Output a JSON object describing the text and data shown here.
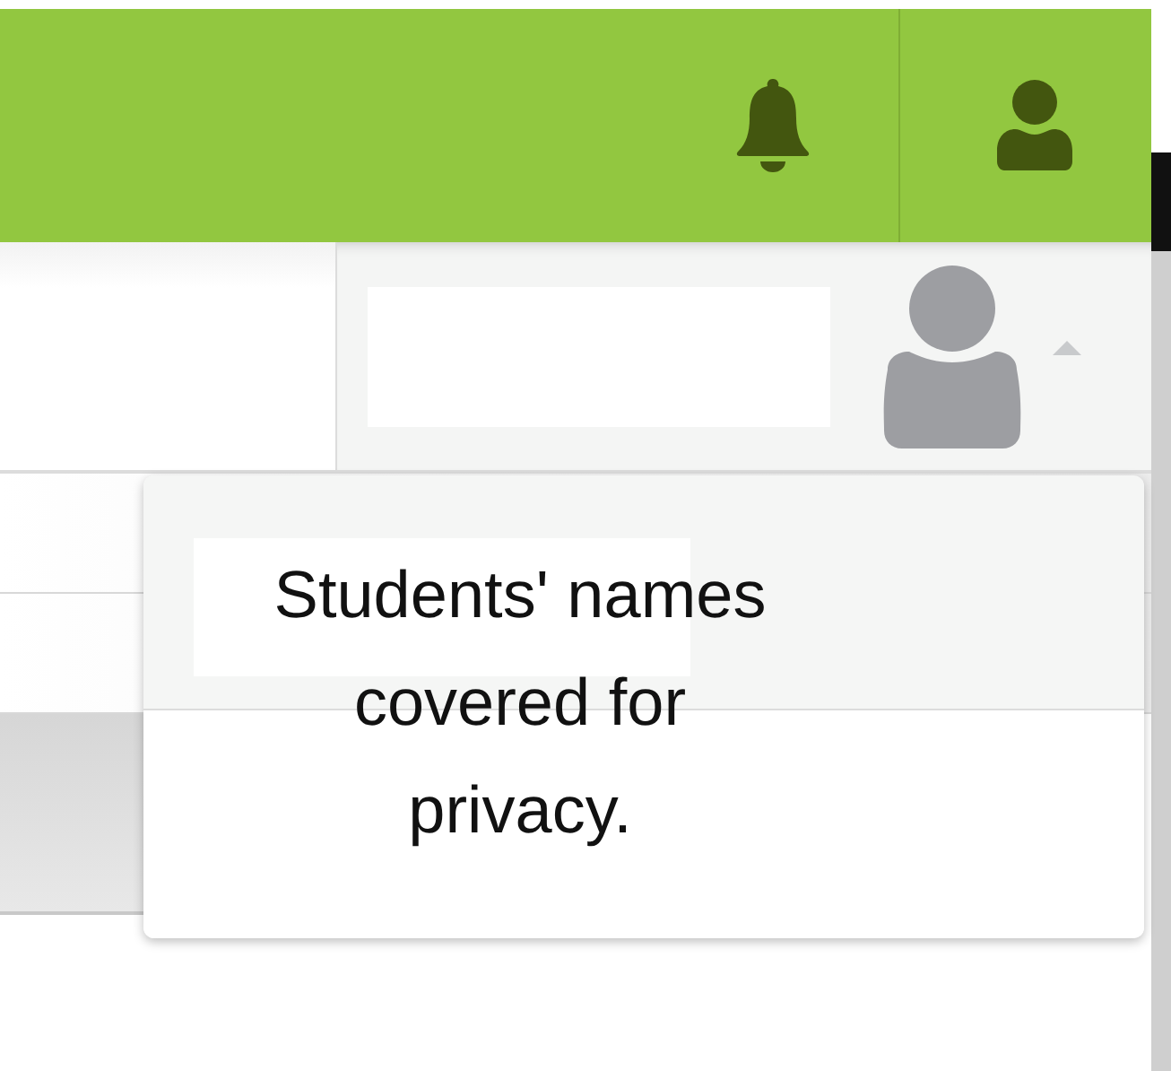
{
  "user_menu": {
    "expanded": true
  },
  "note": "Students' names covered for privacy."
}
